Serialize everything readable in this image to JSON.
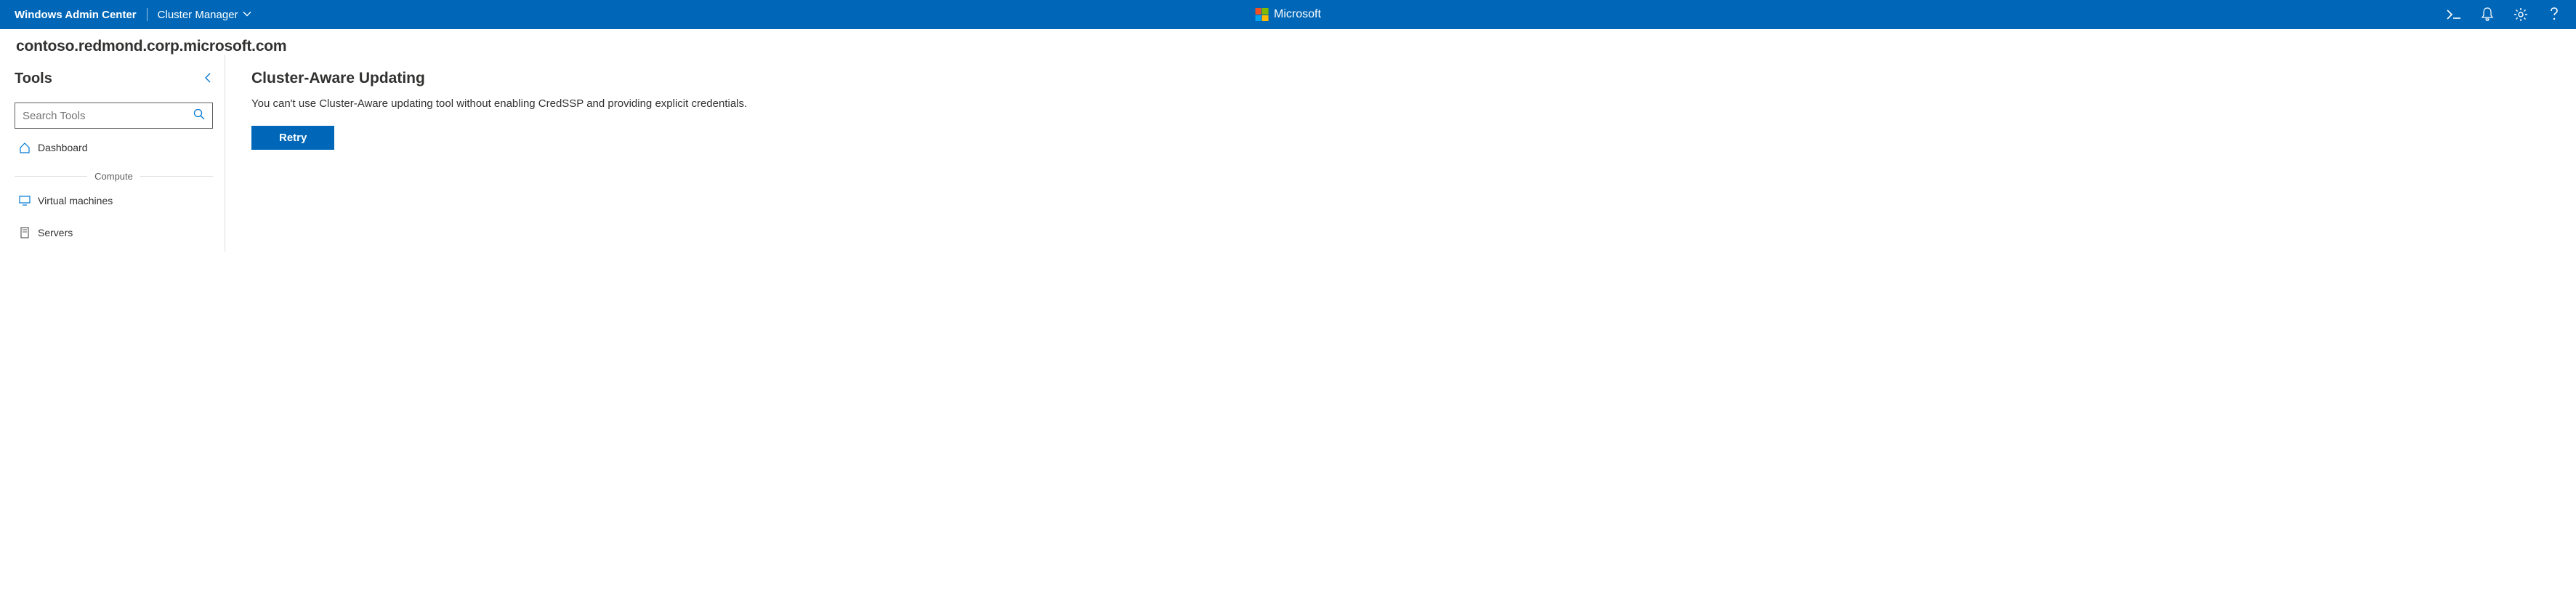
{
  "header": {
    "brand": "Windows Admin Center",
    "context": "Cluster Manager",
    "center_label": "Microsoft"
  },
  "host": "contoso.redmond.corp.microsoft.com",
  "sidebar": {
    "title": "Tools",
    "search_placeholder": "Search Tools",
    "items": [
      {
        "label": "Dashboard"
      },
      {
        "label": "Virtual machines"
      },
      {
        "label": "Servers"
      }
    ],
    "section_compute": "Compute"
  },
  "main": {
    "title": "Cluster-Aware Updating",
    "message": "You can't use Cluster-Aware updating tool without enabling CredSSP and providing explicit credentials.",
    "retry_label": "Retry"
  }
}
